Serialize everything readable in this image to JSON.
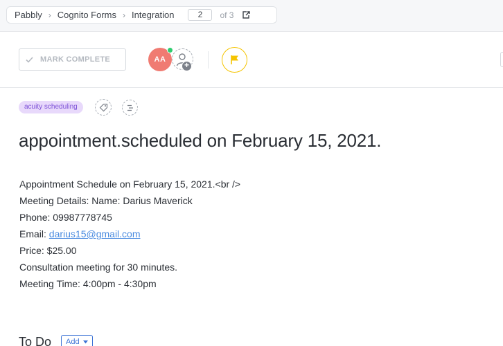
{
  "breadcrumb": {
    "items": [
      "Pabbly",
      "Cognito Forms",
      "Integration"
    ],
    "page_current": "2",
    "page_total": "of 3"
  },
  "toolbar": {
    "mark_complete_label": "MARK COMPLETE",
    "avatar_initials": "AA"
  },
  "tags": [
    "acuity scheduling"
  ],
  "task": {
    "title": "appointment.scheduled on February 15, 2021.",
    "description": {
      "line1": "Appointment Schedule on February 15, 2021.<br />",
      "line2": "Meeting Details: Name: Darius Maverick",
      "line3": "Phone: 09987778745",
      "line4_prefix": "Email: ",
      "line4_link": "darius15@gmail.com",
      "line5": "Price: $25.00",
      "line6": "Consultation meeting for 30 minutes.",
      "line7": "Meeting Time: 4:00pm - 4:30pm"
    }
  },
  "todo": {
    "title": "To Do",
    "add_label": "Add"
  },
  "colors": {
    "avatar": "#f07b72",
    "online": "#2ecd6f",
    "flag": "#f5c400",
    "tag_bg": "#e8d9fb",
    "tag_text": "#7b4fd6",
    "link": "#4a8be0",
    "primary": "#3d73d6"
  }
}
